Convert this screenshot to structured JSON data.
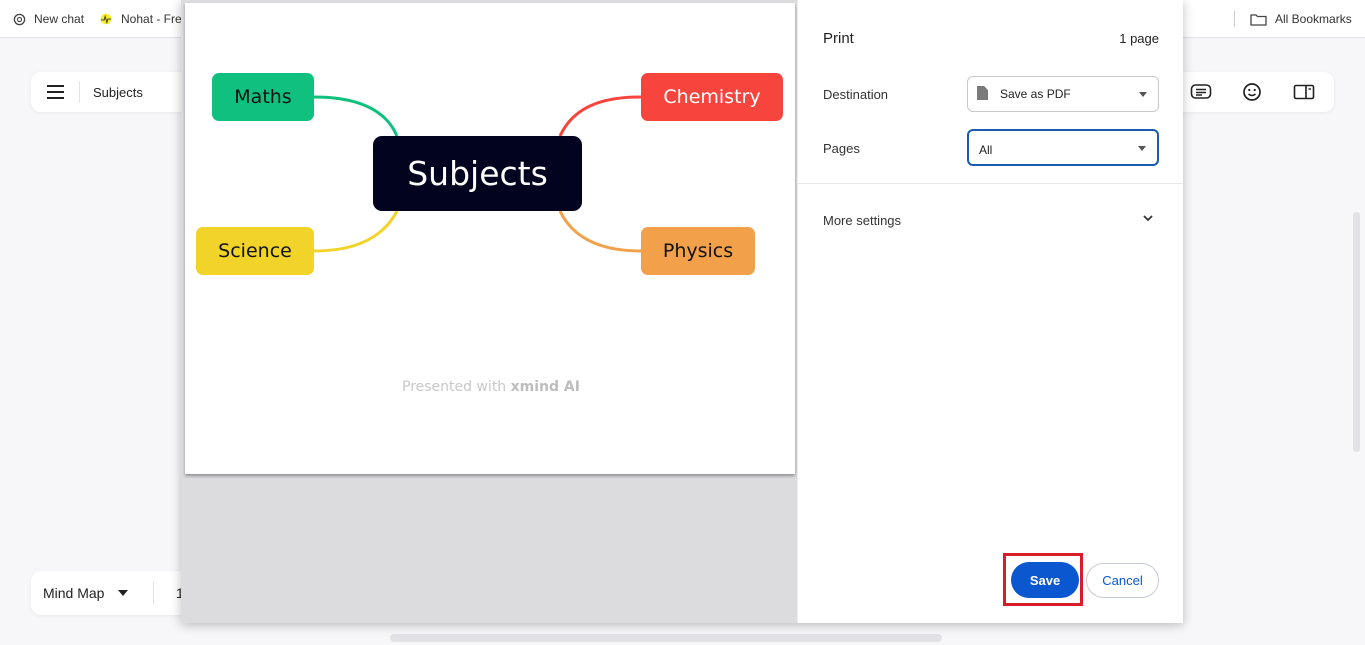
{
  "bookmarks_bar": {
    "items": [
      {
        "label": "New chat",
        "icon": "openai-icon"
      },
      {
        "label": "Nohat - Fre",
        "icon": "nohat-icon"
      }
    ],
    "all_bookmarks": {
      "label": "All Bookmarks",
      "icon": "folder-icon"
    }
  },
  "app": {
    "document_title": "Subjects",
    "menu_icon": "hamburger-menu-icon",
    "right_toolbar_icons": [
      "notes-icon",
      "emoji-icon",
      "panel-toggle-icon"
    ],
    "view_mode": "Mind Map",
    "zoom_partial": "1"
  },
  "print_preview": {
    "mind_map": {
      "central_topic": "Subjects",
      "topics": [
        {
          "label": "Maths",
          "color": "#10c07e",
          "side": "left"
        },
        {
          "label": "Science",
          "color": "#f2d32a",
          "side": "left"
        },
        {
          "label": "Chemistry",
          "color": "#f7453e",
          "side": "right"
        },
        {
          "label": "Physics",
          "color": "#f2a14a",
          "side": "right"
        }
      ],
      "watermark_prefix": "Presented with ",
      "watermark_brand": "xmind AI"
    }
  },
  "print_settings": {
    "title": "Print",
    "page_count": "1 page",
    "destination_label": "Destination",
    "destination_value": "Save as PDF",
    "pages_label": "Pages",
    "pages_value": "All",
    "more_settings_label": "More settings",
    "save_label": "Save",
    "cancel_label": "Cancel",
    "accent_color": "#0b57d0",
    "highlight_color": "#d71d2a"
  }
}
